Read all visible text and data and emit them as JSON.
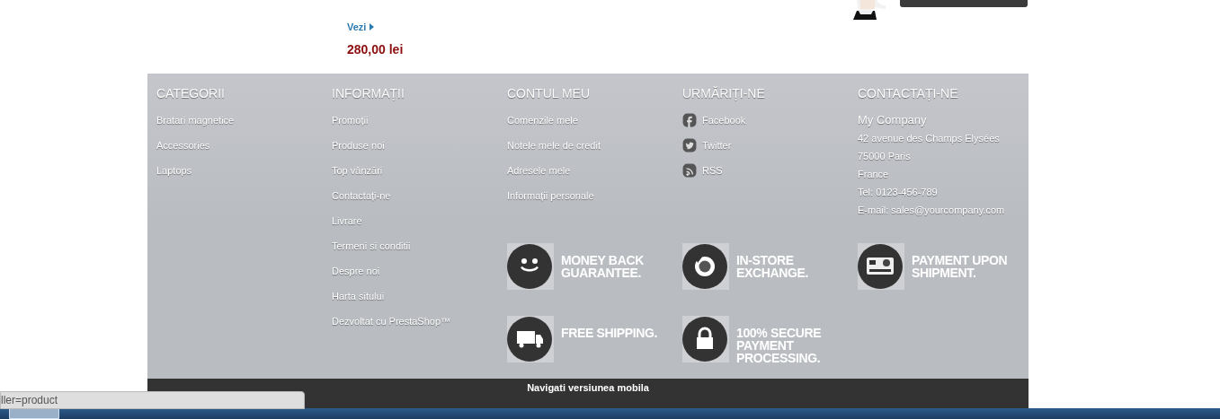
{
  "product": {
    "link": "Vezi",
    "price": "280,00 lei"
  },
  "footer": {
    "columns": [
      {
        "title": "CATEGORII",
        "items": [
          "Bratari magnetice",
          "Accessories",
          "Laptops"
        ]
      },
      {
        "title": "INFORMAȚII",
        "items": [
          "Promoții",
          "Produse noi",
          "Top vânzări",
          "Contactați-ne",
          "Livrare",
          "Termeni si conditii",
          "Despre noi",
          "Harta sitului",
          "Dezvoltat cu PrestaShop™"
        ]
      },
      {
        "title": "CONTUL MEU",
        "items": [
          "Comenzile mele",
          "Notele mele de credit",
          "Adresele mele",
          "Informații personale"
        ]
      },
      {
        "title": "URMĂRIȚI-NE",
        "social": [
          {
            "kind": "facebook",
            "label": "Facebook"
          },
          {
            "kind": "twitter",
            "label": "Twitter"
          },
          {
            "kind": "rss",
            "label": "RSS"
          }
        ]
      },
      {
        "title": "CONTACTAȚI-NE",
        "company": "My Company",
        "lines": [
          "42 avenue des Champs Elysées",
          "75000 Paris",
          "France",
          "Tel: 0123-456-789",
          "E-mail: sales@yourcompany.com"
        ]
      }
    ],
    "features": [
      {
        "kind": "smile",
        "text": "MONEY BACK GUARANTEE."
      },
      {
        "kind": "exchange",
        "text": "IN-STORE EXCHANGE."
      },
      {
        "kind": "card",
        "text": "PAYMENT UPON SHIPMENT."
      },
      {
        "kind": "truck",
        "text": "FREE SHIPPING."
      },
      {
        "kind": "lock",
        "text": "100% SECURE PAYMENT PROCESSING."
      }
    ],
    "mobile_link": "Navigati versiunea mobila"
  },
  "status_bar": {
    "url": "ller=product"
  }
}
